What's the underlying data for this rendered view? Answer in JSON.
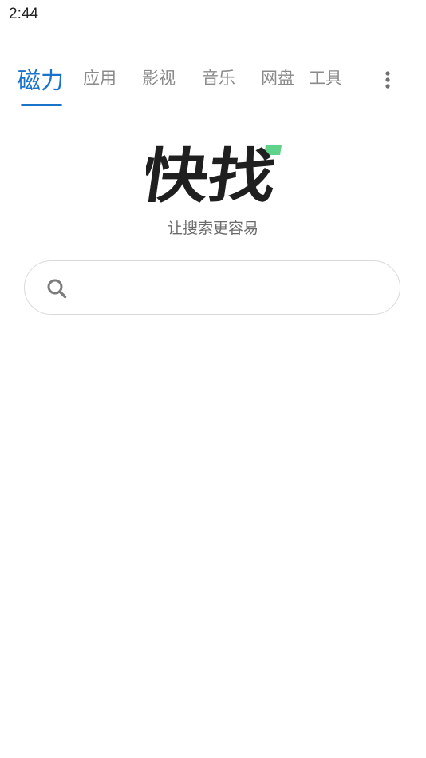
{
  "status_bar": {
    "time": "2:44"
  },
  "tabs": [
    {
      "label": "磁力",
      "active": true
    },
    {
      "label": "应用",
      "active": false
    },
    {
      "label": "影视",
      "active": false
    },
    {
      "label": "音乐",
      "active": false
    },
    {
      "label": "网盘",
      "active": false
    },
    {
      "label": "工具",
      "active": false
    }
  ],
  "more_menu": {
    "icon": "more-vertical-icon"
  },
  "logo": {
    "text": "快找",
    "text_color": "#1f1f1f",
    "accent_color": "#5fd38a"
  },
  "slogan": "让搜索更容易",
  "search": {
    "icon": "search-icon",
    "value": "",
    "placeholder": ""
  },
  "colors": {
    "accent": "#1a73c9",
    "tab_inactive": "#8a8a8a",
    "border": "#d9d9d9"
  }
}
